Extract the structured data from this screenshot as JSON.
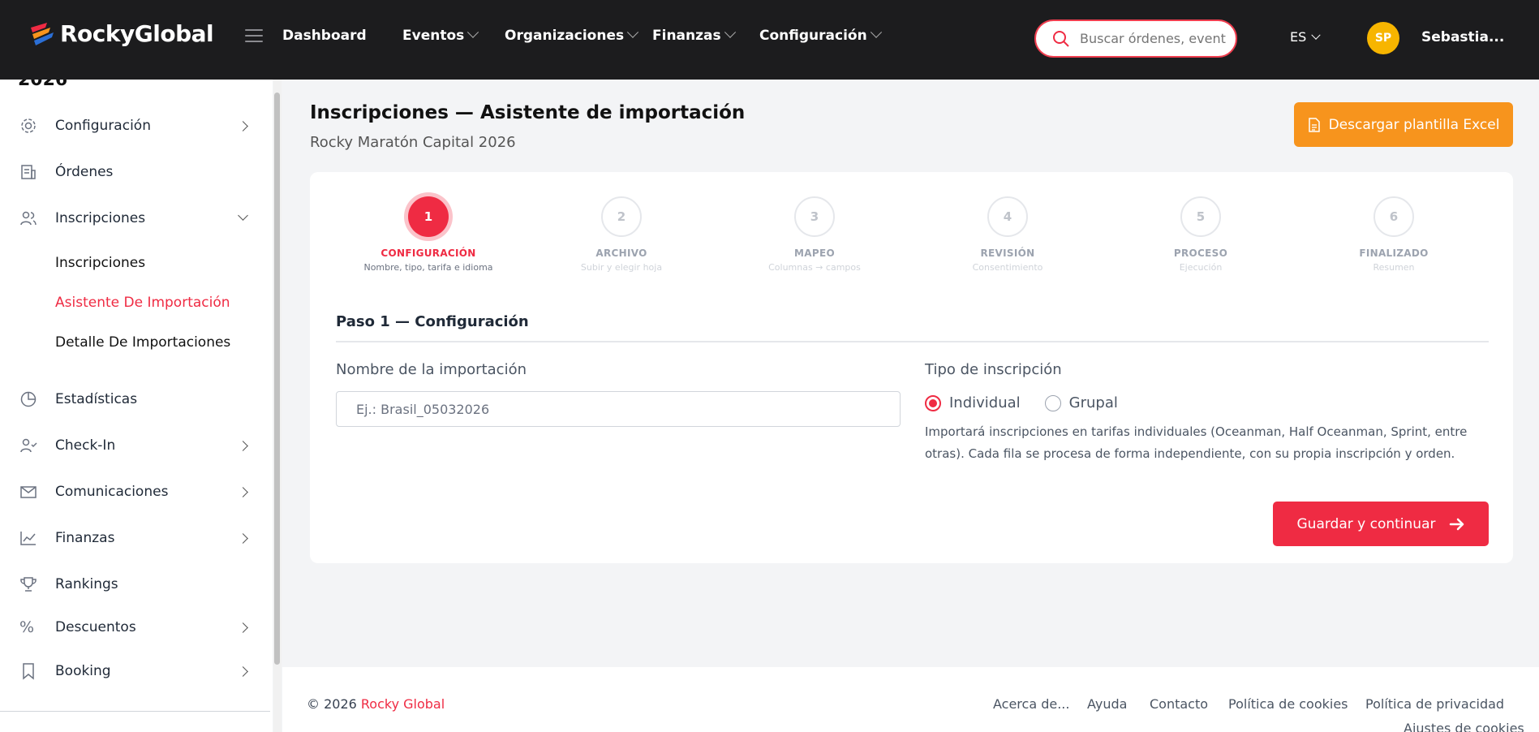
{
  "brand": {
    "name": "RockyGlobal"
  },
  "nav": {
    "items": [
      {
        "label": "Dashboard",
        "has_menu": false
      },
      {
        "label": "Eventos",
        "has_menu": true
      },
      {
        "label": "Organizaciones",
        "has_menu": true
      },
      {
        "label": "Finanzas",
        "has_menu": true
      },
      {
        "label": "Configuración",
        "has_menu": true
      }
    ],
    "search_placeholder": "Buscar órdenes, eventos",
    "language": "ES",
    "avatar_initials": "SP",
    "user_name": "Sebastia..."
  },
  "sidebar": {
    "cut_title": "2026",
    "items": [
      {
        "label": "Configuración",
        "icon": "gear-icon",
        "arrow": "right"
      },
      {
        "label": "Órdenes",
        "icon": "receipt-icon",
        "arrow": "none"
      },
      {
        "label": "Inscripciones",
        "icon": "users-icon",
        "arrow": "down"
      },
      {
        "label": "Estadísticas",
        "icon": "pie-chart-icon",
        "arrow": "none"
      },
      {
        "label": "Check-In",
        "icon": "user-check-icon",
        "arrow": "right"
      },
      {
        "label": "Comunicaciones",
        "icon": "mail-icon",
        "arrow": "right"
      },
      {
        "label": "Finanzas",
        "icon": "line-chart-icon",
        "arrow": "right"
      },
      {
        "label": "Rankings",
        "icon": "trophy-icon",
        "arrow": "none"
      },
      {
        "label": "Descuentos",
        "icon": "percent-icon",
        "arrow": "right"
      },
      {
        "label": "Booking",
        "icon": "bookmark-icon",
        "arrow": "right"
      }
    ],
    "subitems": [
      {
        "label": "Inscripciones",
        "active": false
      },
      {
        "label": "Asistente De Importación",
        "active": true
      },
      {
        "label": "Detalle De Importaciones",
        "active": false
      }
    ]
  },
  "page": {
    "title": "Inscripciones — Asistente de importación",
    "subtitle": "Rocky Maratón Capital 2026",
    "download_button": "Descargar plantilla Excel"
  },
  "wizard": {
    "steps": [
      {
        "number": "1",
        "title": "CONFIGURACIÓN",
        "desc": "Nombre, tipo, tarifa e idioma",
        "active": true
      },
      {
        "number": "2",
        "title": "ARCHIVO",
        "desc": "Subir y elegir hoja",
        "active": false
      },
      {
        "number": "3",
        "title": "MAPEO",
        "desc": "Columnas → campos",
        "active": false
      },
      {
        "number": "4",
        "title": "REVISIÓN",
        "desc": "Consentimiento",
        "active": false
      },
      {
        "number": "5",
        "title": "PROCESO",
        "desc": "Ejecución",
        "active": false
      },
      {
        "number": "6",
        "title": "FINALIZADO",
        "desc": "Resumen",
        "active": false
      }
    ],
    "section_title": "Paso 1 — Configuración",
    "name_label": "Nombre de la importación",
    "name_placeholder": "Ej.: Brasil_05032026",
    "name_value": "",
    "type_label": "Tipo de inscripción",
    "type_options": [
      {
        "label": "Individual",
        "selected": true
      },
      {
        "label": "Grupal",
        "selected": false
      }
    ],
    "help_text": "Importará inscripciones en tarifas individuales (Oceanman, Half Oceanman, Sprint, entre otras). Cada fila se procesa de forma independiente, con su propia inscripción y orden.",
    "save_button": "Guardar y continuar"
  },
  "footer": {
    "copyright": "© 2026",
    "brand": "Rocky Global",
    "links": [
      "Acerca de...",
      "Ayuda",
      "Contacto",
      "Política de cookies",
      "Política de privacidad",
      "Ajustes de cookies"
    ]
  },
  "colors": {
    "accent": "#ef2b43",
    "orange": "#f7941d",
    "topbar": "#1c1c1e",
    "avatar": "#f7b500"
  }
}
